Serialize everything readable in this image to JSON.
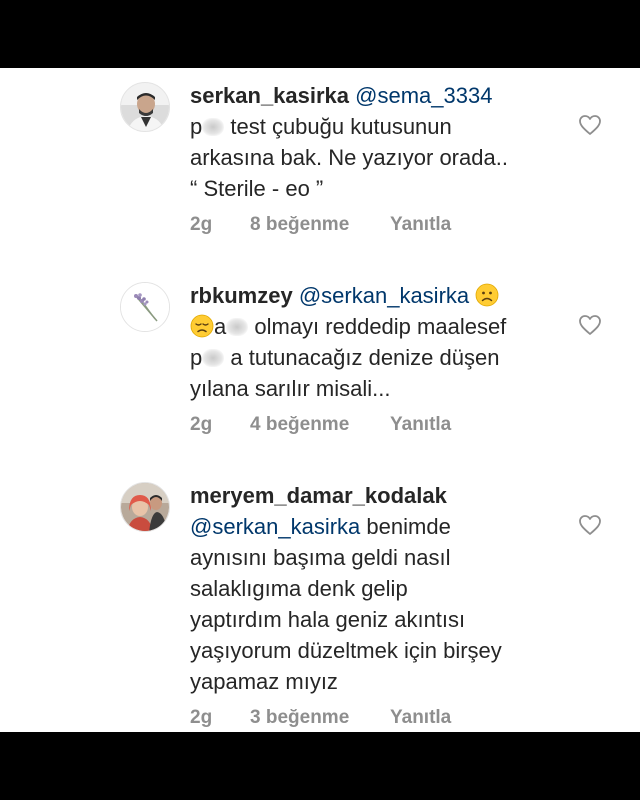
{
  "comments": [
    {
      "username": "serkan_kasirka",
      "mention": "@sema_3334",
      "line1_after_blur": "test çubuğu kutusunun",
      "line1_before_blur": "p",
      "line2": "arkasına bak. Ne yazıyor orada..",
      "line3": "“ Sterile - eo ”",
      "time": "2g",
      "likes": "8 beğenme",
      "reply": "Yanıtla",
      "avatar": "man-avatar-icon"
    },
    {
      "username": "rbkumzey",
      "mention": "@serkan_kasirka",
      "emoji1": "frowning-face-emoji",
      "emoji2": "disappointed-face-emoji",
      "line2_a": "a",
      "line2_b": "olmayı reddedip maalesef",
      "line3_a": "p",
      "line3_b": "a tutunacağız denize düşen",
      "line4": "yılana sarılır misali...",
      "time": "2g",
      "likes": "4 beğenme",
      "reply": "Yanıtla",
      "avatar": "lavender-avatar-icon"
    },
    {
      "username": "meryem_damar_kodalak",
      "mention": "@serkan_kasirka",
      "line2_tail": "benimde",
      "line3": "aynısını başıma geldi nasıl",
      "line4": "salaklıgıma denk gelip",
      "line5": "yaptırdım hala geniz akıntısı",
      "line6": "yaşıyorum düzeltmek için birşey",
      "line7": "yapamaz mıyız",
      "time": "2g",
      "likes": "3 beğenme",
      "reply": "Yanıtla",
      "avatar": "couple-avatar-icon"
    }
  ],
  "colors": {
    "text": "#262626",
    "mention": "#00376b",
    "meta": "#8e8e8e",
    "background": "#ffffff",
    "letterbox": "#000000"
  }
}
